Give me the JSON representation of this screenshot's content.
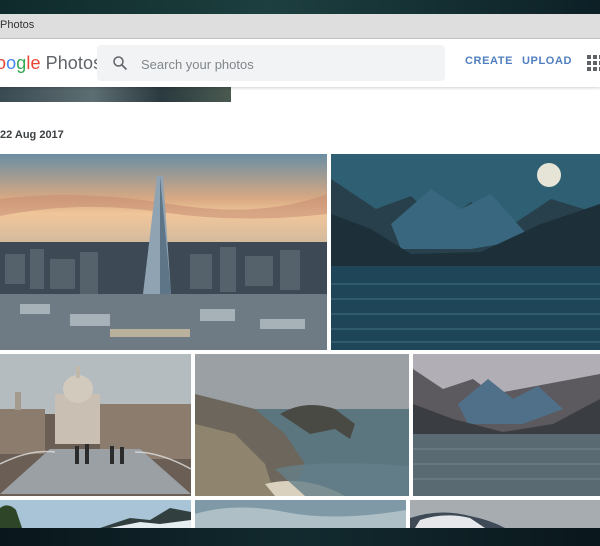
{
  "window": {
    "title": "Photos"
  },
  "header": {
    "logo": {
      "g1": "o",
      "g2": "o",
      "g3": "g",
      "g4": "le",
      "product": "Photos"
    },
    "search": {
      "placeholder": "Search your photos"
    },
    "create_label": "CREATE",
    "upload_label": "UPLOAD",
    "icons": {
      "search": "search-icon",
      "apps": "apps-grid-icon"
    }
  },
  "gallery": {
    "date_label": "22 Aug 2017",
    "photos": [
      {
        "name": "photo-city-shard",
        "subject": "city skyline at sunset"
      },
      {
        "name": "photo-mountain-lake-moon",
        "subject": "mountain lake with moon"
      },
      {
        "name": "photo-st-pauls",
        "subject": "St Paul's cathedral bridge"
      },
      {
        "name": "photo-coastal-arch",
        "subject": "coastal rock arch"
      },
      {
        "name": "photo-mountain-lake",
        "subject": "mountain lake"
      },
      {
        "name": "photo-trees",
        "subject": "trees and sky"
      },
      {
        "name": "photo-clouds",
        "subject": "cloudy sky"
      },
      {
        "name": "photo-snowy-hill",
        "subject": "snowy hill"
      }
    ]
  },
  "colors": {
    "accent": "#4f7fbf",
    "titlebar": "#dedede"
  }
}
